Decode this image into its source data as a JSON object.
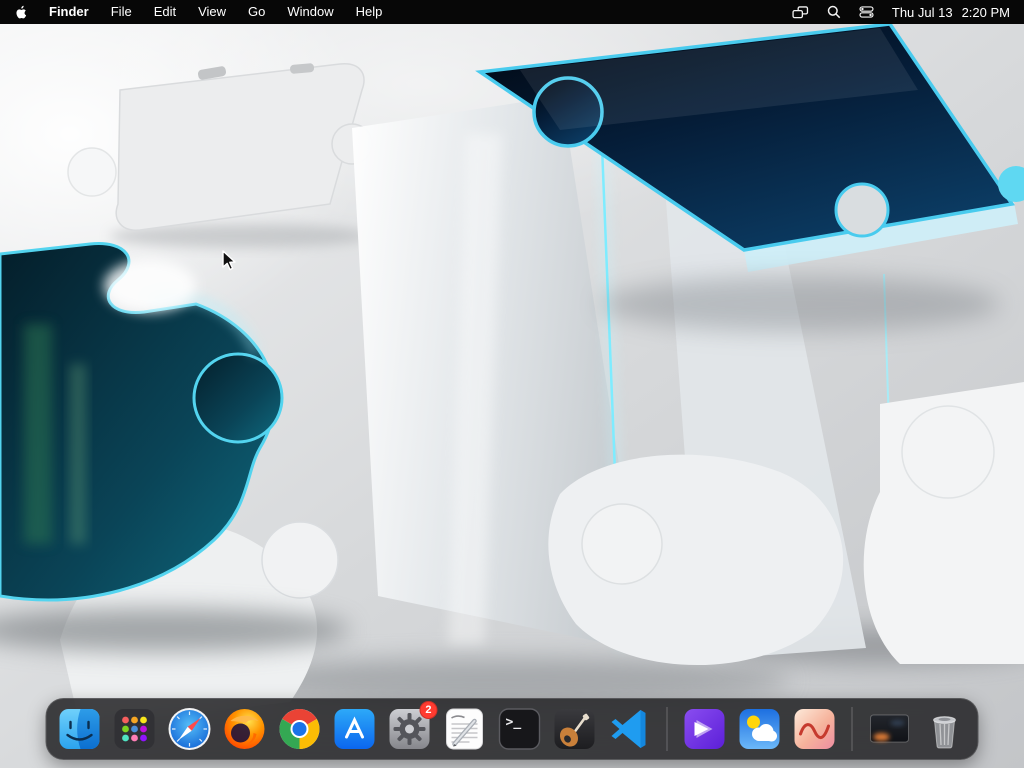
{
  "menu_bar": {
    "app_name": "Finder",
    "menus": [
      "File",
      "Edit",
      "View",
      "Go",
      "Window",
      "Help"
    ],
    "status_icons": [
      "screen-mirroring-icon",
      "spotlight-search-icon",
      "control-center-icon"
    ],
    "clock_date": "Thu Jul 13",
    "clock_time": "2:20 PM"
  },
  "desktop": {
    "wallpaper_theme": "glossy-3d-puzzle-pieces",
    "wallpaper_accent": "#49cbee",
    "wallpaper_dark": "#06213b",
    "wallpaper_base": "#d5d6d8"
  },
  "dock": {
    "terminal_glyph": "&gt;_",
    "terminal_prompt": ">_",
    "settings_badge": "2",
    "apps": [
      "finder",
      "launchpad",
      "safari",
      "firefox",
      "chrome",
      "app-store",
      "system-settings",
      "textedit",
      "terminal",
      "garageband",
      "vscode",
      "purple-app",
      "weather",
      "waveform-app",
      "file-thumbnail",
      "trash"
    ]
  }
}
